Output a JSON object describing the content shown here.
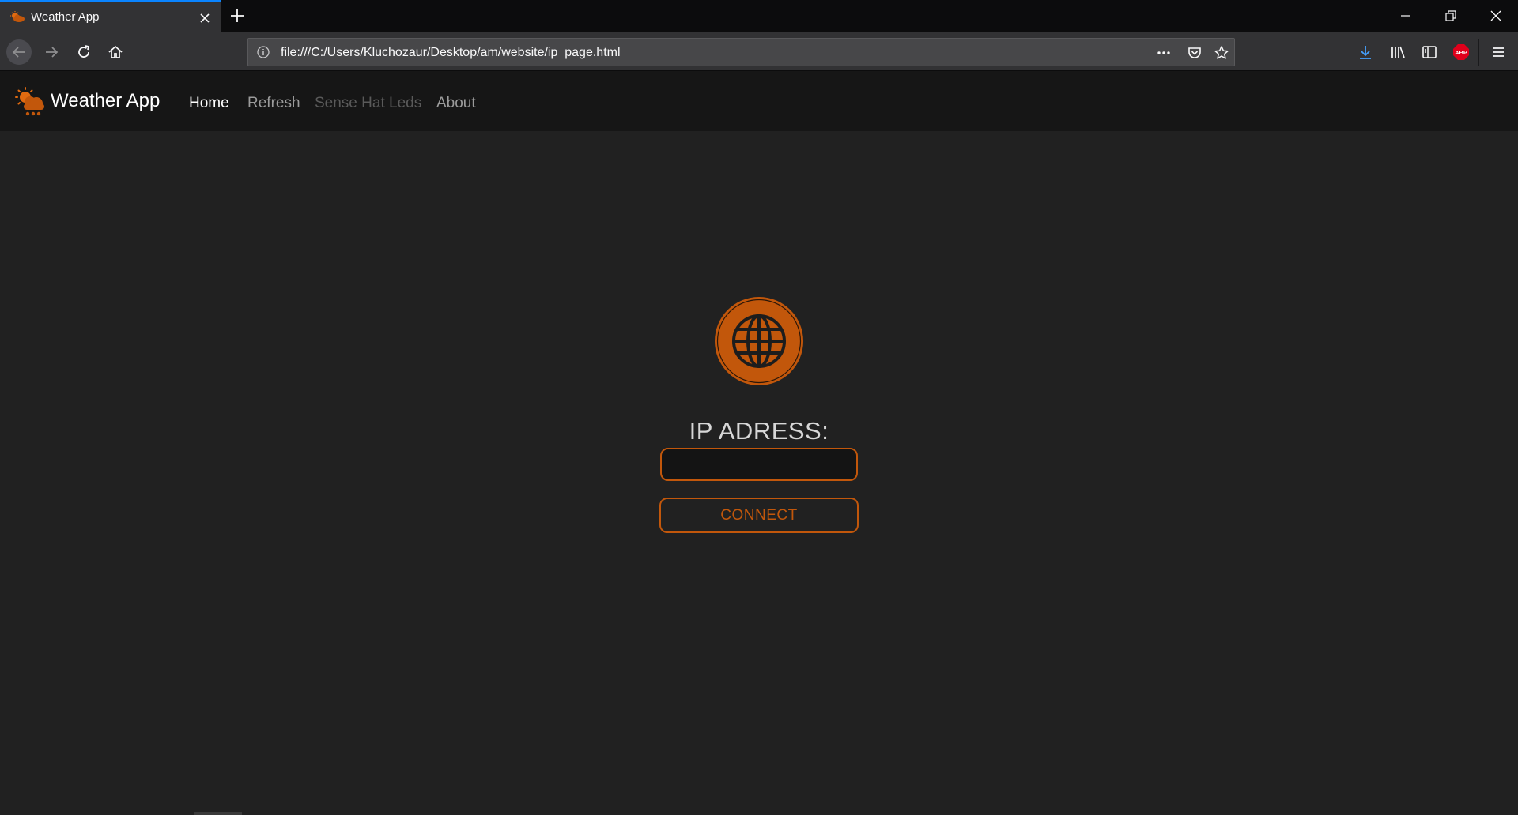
{
  "browser": {
    "tab": {
      "title": "Weather App"
    },
    "url": "file:///C:/Users/Kluchozaur/Desktop/am/website/ip_page.html",
    "icons": {
      "tab_favicon": "weather-cloud-sun-icon",
      "tab_close": "close-icon",
      "new_tab": "plus-icon",
      "back": "arrow-left-icon",
      "forward": "arrow-right-icon",
      "reload": "reload-icon",
      "home": "home-icon",
      "page_info": "info-icon",
      "page_actions": "ellipsis-icon",
      "pocket": "pocket-icon",
      "bookmark": "star-icon",
      "downloads": "download-icon",
      "library": "library-icon",
      "sidebar": "sidebar-icon",
      "adblock": "abp-icon",
      "menu": "hamburger-icon",
      "minimize": "minimize-icon",
      "restore": "restore-icon",
      "close_window": "close-icon"
    },
    "adblock_label": "ABP"
  },
  "app": {
    "brand": "Weather App",
    "nav": [
      {
        "label": "Home",
        "state": "active"
      },
      {
        "label": "Refresh",
        "state": "normal"
      },
      {
        "label": "Sense Hat Leds",
        "state": "disabled"
      },
      {
        "label": "About",
        "state": "normal"
      }
    ],
    "main": {
      "icon": "globe-icon",
      "ip_label": "IP ADRESS:",
      "ip_value": "",
      "connect_label": "CONNECT"
    }
  },
  "colors": {
    "accent": "#c2570b",
    "page_bg": "#212121",
    "navbar_bg": "#161616",
    "browser_tab_active": "#323234",
    "browser_highlight": "#0a84ff"
  }
}
